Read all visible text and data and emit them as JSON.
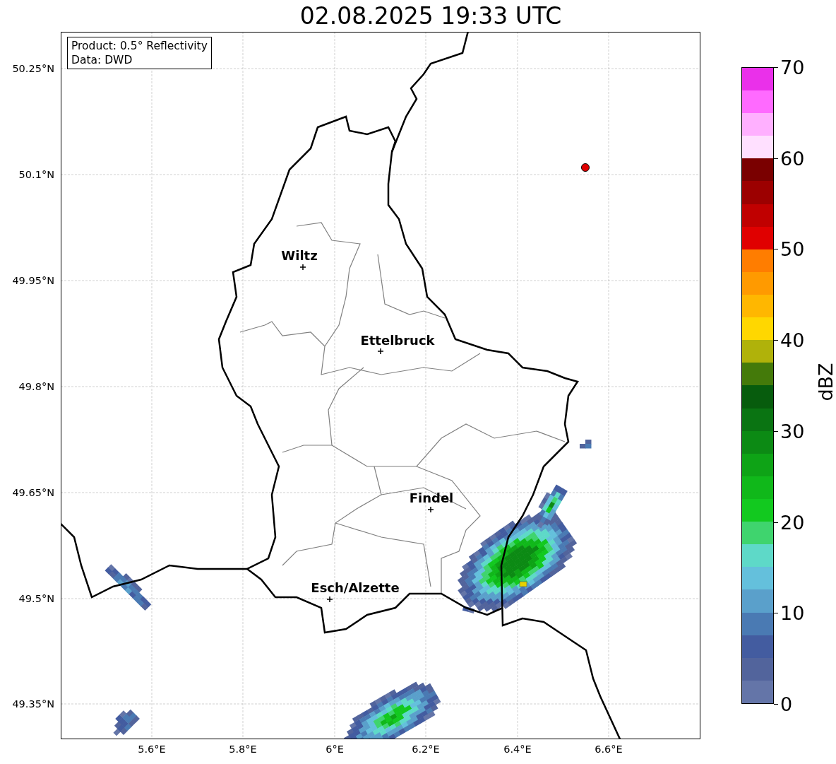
{
  "title": "02.08.2025 19:33 UTC",
  "info_box": [
    "Product: 0.5° Reflectivity",
    "Data: DWD"
  ],
  "y_ticks": [
    "50.25°N",
    "50.1°N",
    "49.95°N",
    "49.8°N",
    "49.65°N",
    "49.5°N",
    "49.35°N"
  ],
  "x_ticks": [
    "5.6°E",
    "5.8°E",
    "6°E",
    "6.2°E",
    "6.4°E",
    "6.6°E"
  ],
  "cities": [
    {
      "name": "Wiltz"
    },
    {
      "name": "Ettelbruck"
    },
    {
      "name": "Findel"
    },
    {
      "name": "Esch/Alzette"
    }
  ],
  "colorbar": {
    "label": "dBZ",
    "ticks": [
      "70",
      "60",
      "50",
      "40",
      "30",
      "20",
      "10",
      "0"
    ]
  }
}
